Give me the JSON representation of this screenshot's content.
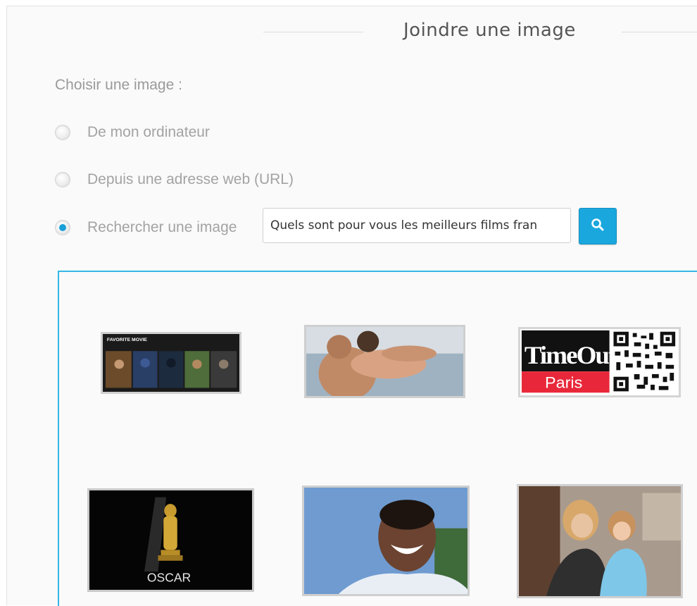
{
  "dialog": {
    "title": "Joindre une image",
    "choose_label": "Choisir une image :"
  },
  "options": [
    {
      "label": "De mon ordinateur",
      "checked": false
    },
    {
      "label": "Depuis une adresse web (URL)",
      "checked": false
    },
    {
      "label": "Rechercher une image",
      "checked": true
    }
  ],
  "search": {
    "value": "Quels sont pour vous les meilleurs films fran",
    "button_icon": "search-icon"
  },
  "results": [
    {
      "name": "favorite-movie-collage",
      "caption": "FAVORITE MOVIE"
    },
    {
      "name": "couple-beach-photo"
    },
    {
      "name": "timeout-paris-logo",
      "caption_top": "TimeOut",
      "caption_bottom": "Paris"
    },
    {
      "name": "oscar-statuette",
      "caption": "OSCAR"
    },
    {
      "name": "smiling-man-portrait"
    },
    {
      "name": "woman-child-photo"
    }
  ],
  "colors": {
    "accent": "#1aa7de",
    "results_border": "#33b7e6",
    "radio_checked": "#1a9fd8"
  }
}
